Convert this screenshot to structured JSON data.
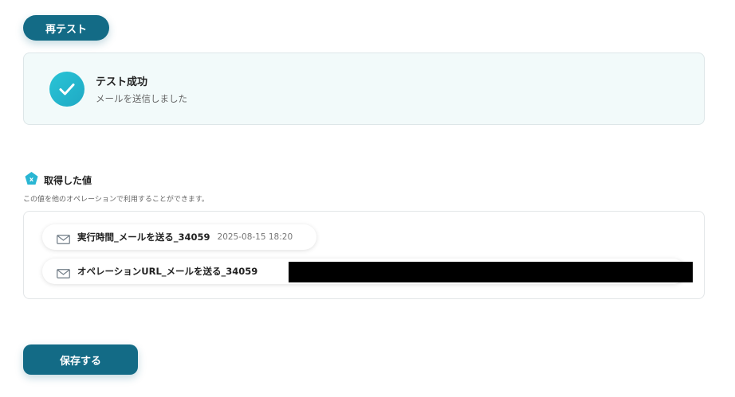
{
  "buttons": {
    "retest_label": "再テスト",
    "save_label": "保存する"
  },
  "status": {
    "title": "テスト成功",
    "message": "メールを送信しました",
    "icon": "check-circle-icon"
  },
  "obtained_values": {
    "title": "取得した値",
    "description": "この値を他のオペレーションで利用することができます。",
    "icon": "variable-x-icon",
    "items": [
      {
        "label": "実行時間_メールを送る_34059",
        "value": "2025-08-15 18:20",
        "icon": "mail-icon"
      },
      {
        "label": "オペレーションURL_メールを送る_34059",
        "value": "",
        "icon": "mail-icon",
        "redacted": true
      }
    ]
  },
  "colors": {
    "accent": "#136b86",
    "check": "#29c4d6",
    "success_bg": "#f2fafa"
  }
}
